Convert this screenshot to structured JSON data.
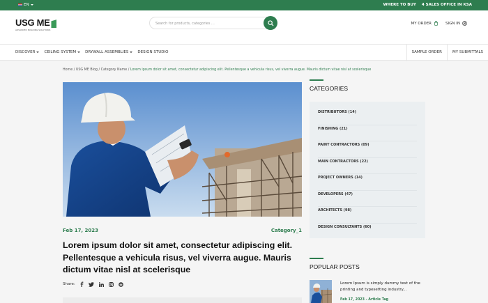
{
  "topbar": {
    "lang": "EN",
    "where_to_buy": "WHERE TO BUY",
    "sales_office": "4 SALES OFFICE IN KSA"
  },
  "header": {
    "logo_text": "USG ME",
    "logo_tagline": "ADVANCED BUILDING SOLUTIONS",
    "search_placeholder": "Search for products, categories ...",
    "my_order": "MY ORDER",
    "sign_in": "SIGN IN"
  },
  "nav": {
    "items": [
      "DISCOVER",
      "CEILING SYSTEM",
      "DRYWALL ASSEMBLIES",
      "DESIGN STUDIO"
    ],
    "sample_order": "SAMPLE ORDER",
    "my_submittals": "MY SUBMITTALS"
  },
  "breadcrumb": {
    "trail": "Home / USG ME Blog / Category Name / ",
    "current": "Lorem ipsum dolor sit amet, consectetur adipiscing elit. Pellentesque a vehicula risus, vel viverra augue. Mauris dictum vitae nisl at scelerisque"
  },
  "article": {
    "date": "Feb 17, 2023",
    "category": "Category_1",
    "title": "Lorem ipsum dolor sit amet, consectetur adipiscing elit. Pellentesque a vehicula risus, vel viverra augue. Mauris dictum vitae nisl at scelerisque",
    "share_label": "Share:"
  },
  "sidebar": {
    "categories_title": "CATEGORIES",
    "categories": [
      "DISTRIBUTORS (14)",
      "FINISHING (21)",
      "PAINT CONTRACTORS (09)",
      "MAIN CONTRACTORS (22)",
      "PROJECT OWNERS (14)",
      "DEVELOPERS (47)",
      "ARCHITECTS (98)",
      "DESIGN CONSULTANTS (60)"
    ],
    "popular_title": "POPULAR POSTS",
    "popular_post": {
      "title": "Lorem Ipsum is simply dummy text of the printing and typesetting industry...",
      "meta": "Feb 17, 2023 - Article Tag"
    }
  },
  "colors": {
    "brand_green": "#2e7d4f",
    "sidebar_bg": "#ebeff1"
  }
}
